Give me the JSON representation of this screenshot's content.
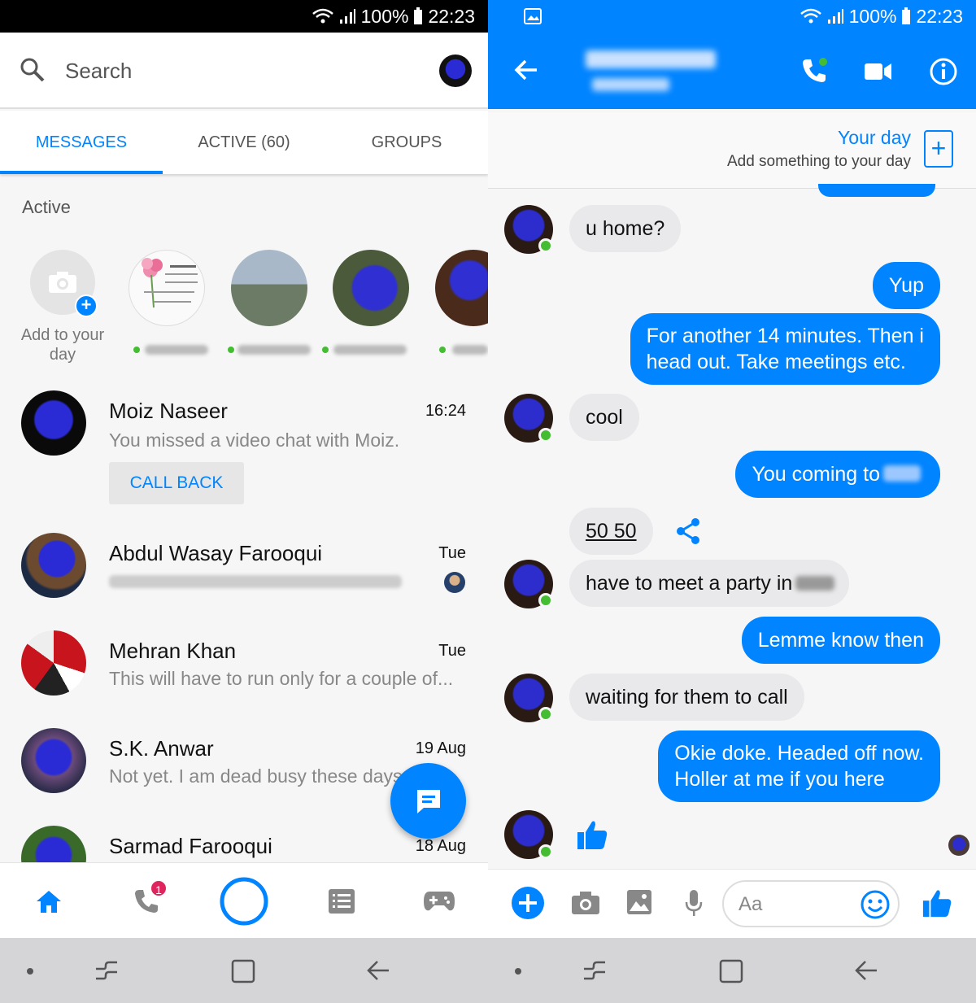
{
  "status": {
    "battery": "100%",
    "time": "22:23"
  },
  "left": {
    "search": {
      "placeholder": "Search"
    },
    "tabs": [
      {
        "label": "MESSAGES",
        "active": true
      },
      {
        "label": "ACTIVE (60)",
        "active": false
      },
      {
        "label": "GROUPS",
        "active": false
      }
    ],
    "active_section": {
      "title": "Active",
      "add_label": "Add to your day"
    },
    "conversations": [
      {
        "name": "Moiz Naseer",
        "time": "16:24",
        "snippet": "You missed a video chat with Moiz.",
        "action": "CALL BACK"
      },
      {
        "name": "Abdul Wasay Farooqui",
        "time": "Tue",
        "snippet": ""
      },
      {
        "name": "Mehran Khan",
        "time": "Tue",
        "snippet": "This will have to run only for a couple of..."
      },
      {
        "name": "S.K. Anwar",
        "time": "19 Aug",
        "snippet": "Not yet. I am dead busy these days"
      },
      {
        "name": "Sarmad Farooqui",
        "time": "18 Aug",
        "snippet": ""
      }
    ],
    "nav": {
      "calls_badge": "1"
    }
  },
  "right": {
    "your_day": {
      "title": "Your day",
      "subtitle": "Add something to your day"
    },
    "messages": [
      {
        "from": "them",
        "text": "u home?"
      },
      {
        "from": "me",
        "text": "Yup"
      },
      {
        "from": "me",
        "text": "For another 14 minutes. Then i",
        "text2": "head out. Take meetings etc."
      },
      {
        "from": "them",
        "text": "cool"
      },
      {
        "from": "me",
        "text": "You coming to"
      },
      {
        "from": "them",
        "text": "50 50"
      },
      {
        "from": "them",
        "text": "have to meet a party in"
      },
      {
        "from": "me",
        "text": "Lemme know then"
      },
      {
        "from": "them",
        "text": "waiting for them to call"
      },
      {
        "from": "me",
        "text": "Okie doke. Headed off now.",
        "text2": "Holler at me if you here"
      }
    ],
    "composer": {
      "placeholder": "Aa"
    }
  },
  "colors": {
    "accent": "#0084ff",
    "online": "#44bd32",
    "badge": "#e0245e"
  }
}
